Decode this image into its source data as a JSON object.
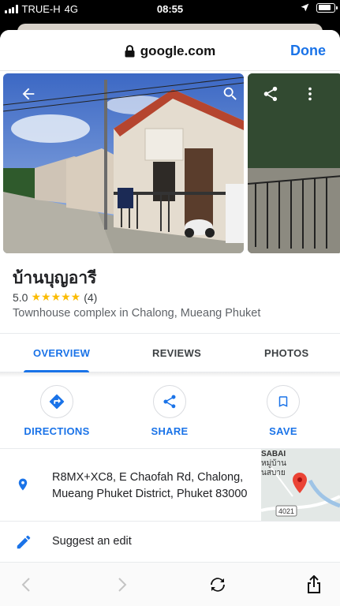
{
  "status_bar": {
    "carrier": "TRUE-H",
    "network": "4G",
    "time": "08:55"
  },
  "browser": {
    "domain": "google.com",
    "done_label": "Done"
  },
  "place": {
    "name": "บ้านบุญอารี",
    "rating": "5.0",
    "stars": "★★★★★",
    "review_count": "(4)",
    "category": "Townhouse complex in Chalong, Mueang Phuket"
  },
  "tabs": [
    {
      "label": "OVERVIEW",
      "active": true
    },
    {
      "label": "REVIEWS",
      "active": false
    },
    {
      "label": "PHOTOS",
      "active": false
    }
  ],
  "actions": [
    {
      "label": "DIRECTIONS",
      "icon": "directions-icon"
    },
    {
      "label": "SHARE",
      "icon": "share-icon"
    },
    {
      "label": "SAVE",
      "icon": "bookmark-icon"
    }
  ],
  "address": {
    "line1": "R8MX+XC8, E Chaofah Rd, Chalong,",
    "line2": "Mueang Phuket District, Phuket 83000"
  },
  "map": {
    "label_top": "SABAI",
    "label_thai": "หมู่บ้าน",
    "label_thai2": "นสบาย",
    "road_number": "4021"
  },
  "suggest_edit": "Suggest an edit",
  "colors": {
    "accent": "#1a73e8",
    "star": "#fbbc04",
    "pin_red": "#ea4335"
  }
}
